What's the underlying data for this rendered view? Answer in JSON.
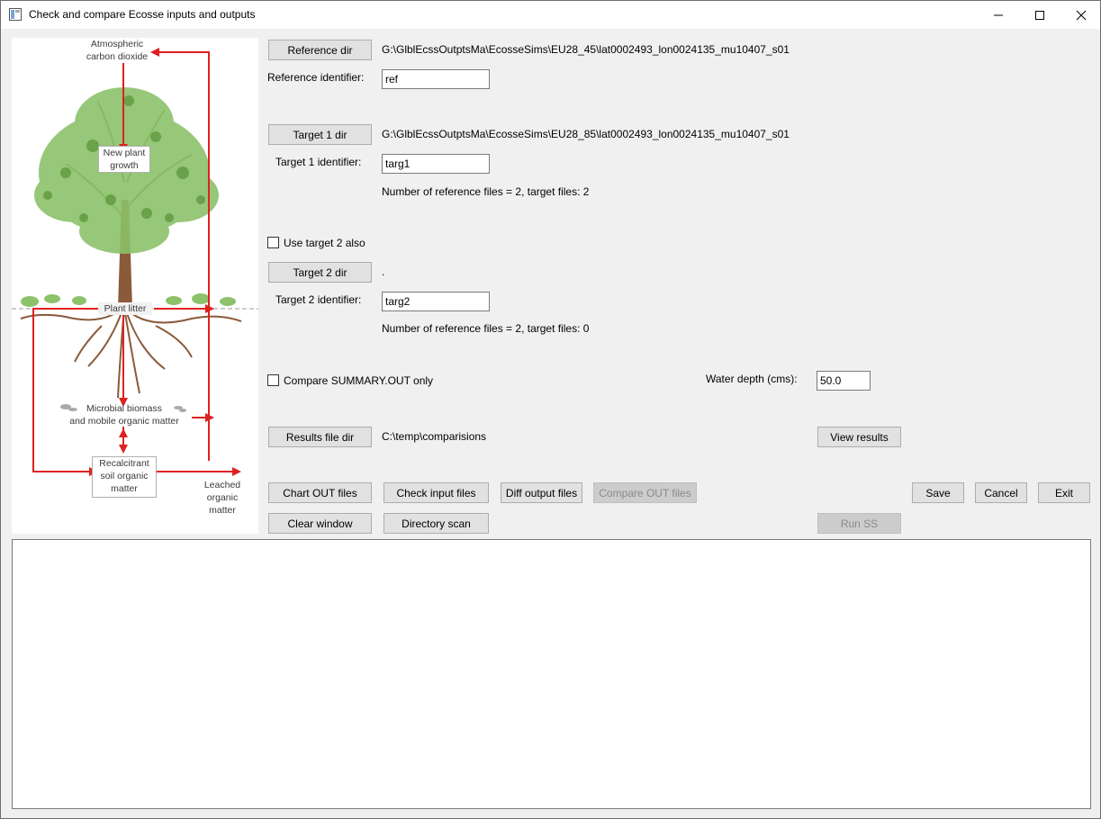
{
  "window": {
    "title": "Check and compare Ecosse inputs and outputs"
  },
  "illustration": {
    "atmospheric": "Atmospheric\ncarbon dioxide",
    "new_plant": "New plant\ngrowth",
    "plant_litter": "Plant litter",
    "microbial": "Microbial biomass\nand mobile organic matter",
    "recalcitrant": "Recalcitrant\nsoil organic\nmatter",
    "leached": "Leached\norganic\nmatter",
    "arrow_color": "#e02020"
  },
  "reference": {
    "dir_button": "Reference dir",
    "dir_path": "G:\\GlblEcssOutptsMa\\EcosseSims\\EU28_45\\lat0002493_lon0024135_mu10407_s01",
    "identifier_label": "Reference identifier:",
    "identifier_value": "ref"
  },
  "target1": {
    "dir_button": "Target 1 dir",
    "dir_path": "G:\\GlblEcssOutptsMa\\EcosseSims\\EU28_85\\lat0002493_lon0024135_mu10407_s01",
    "identifier_label": "Target 1 identifier:",
    "identifier_value": "targ1",
    "file_count": "Number of reference files = 2, target files: 2"
  },
  "target2": {
    "use_label": "Use target 2 also",
    "use_checked": false,
    "dir_button": "Target 2 dir",
    "dir_path": ".",
    "identifier_label": "Target 2 identifier:",
    "identifier_value": "targ2",
    "file_count": "Number of reference files = 2, target files: 0"
  },
  "options": {
    "summary_only_label": "Compare SUMMARY.OUT only",
    "summary_only_checked": false,
    "water_depth_label": "Water depth (cms):",
    "water_depth_value": "50.0"
  },
  "results": {
    "dir_button": "Results file dir",
    "dir_path": "C:\\temp\\comparisions",
    "view_button": "View results"
  },
  "actions": {
    "chart_out": "Chart OUT files",
    "check_input": "Check input files",
    "diff_output": "Diff output files",
    "compare_out": "Compare OUT files",
    "save": "Save",
    "cancel": "Cancel",
    "exit": "Exit",
    "clear_window": "Clear window",
    "directory_scan": "Directory scan",
    "run_ss": "Run SS"
  },
  "log": {
    "text": ""
  }
}
